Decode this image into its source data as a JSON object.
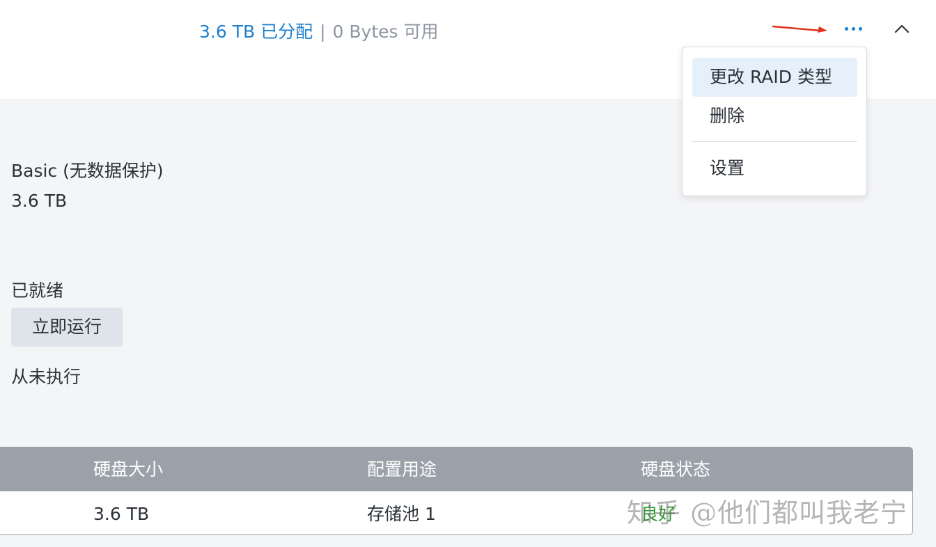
{
  "header": {
    "allocated": "3.6 TB 已分配",
    "separator": "|",
    "available": "0 Bytes 可用"
  },
  "icons": {
    "more": "more-horizontal-icon",
    "collapse": "chevron-up-icon",
    "annotation": "red-arrow-icon"
  },
  "menu": {
    "items": [
      {
        "label": "更改 RAID 类型",
        "active": true
      },
      {
        "label": "删除",
        "active": false
      },
      {
        "label": "设置",
        "active": false
      }
    ]
  },
  "info": {
    "raid_type": "Basic (无数据保护)",
    "capacity": "3.6 TB",
    "scrub_status": "已就绪",
    "run_now_label": "立即运行",
    "last_run": "从未执行"
  },
  "table": {
    "columns": [
      "硬盘大小",
      "配置用途",
      "硬盘状态"
    ],
    "rows": [
      [
        "3.6 TB",
        "存储池 1",
        "良好"
      ]
    ]
  },
  "watermark": "知乎 @他们都叫我老宁",
  "colors": {
    "accent": "#1f7fcf",
    "muted_text": "#8d96a0",
    "status_good": "#2e9a2e",
    "annotation_arrow": "#e0321f",
    "table_header": "#9aa1a8"
  }
}
